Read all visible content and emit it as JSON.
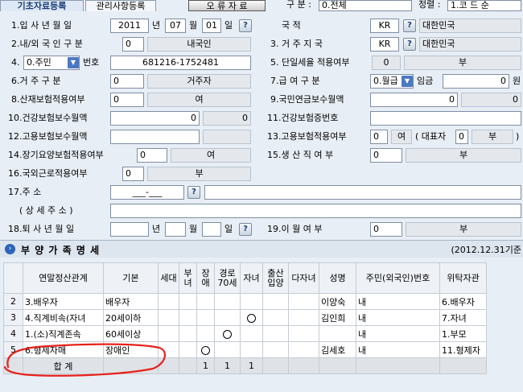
{
  "tabs": {
    "basic": "기초자료등록",
    "management": "관리사항등록"
  },
  "toolbar": {
    "error_button": "오 류 자 료",
    "gubun_label": "구 분 :",
    "gubun_value": "0.전체",
    "sort_label": "정렬 :",
    "sort_value": "1.코 드 순"
  },
  "form": {
    "f1_label": "1.입 사 년 월 일",
    "f1_year": "2011",
    "f1_year_unit": "년",
    "f1_month": "07",
    "f1_month_unit": "월",
    "f1_day": "01",
    "f1_day_unit": "일",
    "country_label": "국                적",
    "country_code": "KR",
    "country_name": "대한민국",
    "f2_label": "2.내/외 국 인 구 분",
    "f2_code": "0",
    "f2_value": "내국인",
    "f3_label": "3. 거  주  지  국",
    "f3_code": "KR",
    "f3_name": "대한민국",
    "f4_label": "4.",
    "f4_select": "0.주민",
    "f4_sub": "번호",
    "f4_value": "681216-1752481",
    "f5_label": "5. 단일세율 적용여부",
    "f5_code": "0",
    "f5_value": "부",
    "f6_label": "6.거  주  구  분",
    "f6_code": "0",
    "f6_value": "거주자",
    "f7_label": "7.급  여  구  분",
    "f7_select": "0.월급",
    "f7_sub": "임금",
    "f7_value": "0",
    "f7_unit": "원",
    "f8_label": "8.산재보험적용여부",
    "f8_code": "0",
    "f8_value": "여",
    "f9_label": "9.국민연금보수월액",
    "f9_value1": "0",
    "f9_value2": "0",
    "f10_label": "10.건강보험보수월액",
    "f10_value1": "0",
    "f10_value2": "0",
    "f11_label": "11.건강보험증번호",
    "f12_label": "12.고용보험보수월액",
    "f13_label": "13.고용보험적용여부",
    "f13_code": "0",
    "f13_value": "여",
    "f13_rep": "( 대표자",
    "f13_rep_code": "0",
    "f13_rep_value": "부",
    "f13_close": ")",
    "f14_label": "14.장기요양보험적용여부",
    "f14_code": "0",
    "f14_value": "여",
    "f15_label": "15.생  산  직  여  부",
    "f15_code": "0",
    "f15_value": "부",
    "f16_label": "16.국외근로적용여부",
    "f16_code": "0",
    "f16_value": "부",
    "f17_label": "17.주                 소",
    "f17_zip": "___-___",
    "f17b_label": "( 상  세  주  소 )",
    "f18_label": "18.퇴 사 년 월 일",
    "f18_year_unit": "년",
    "f18_month_unit": "월",
    "f18_day_unit": "일",
    "f19_label": "19.이  월  여  부",
    "f19_code": "0",
    "f19_value": "부"
  },
  "section": {
    "title": "부 양 가 족 명 세",
    "date": "(2012.12.31기준"
  },
  "grid": {
    "headers": [
      "연말정산관계",
      "기본",
      "세대",
      "부녀",
      "장애",
      "경로70세",
      "자녀",
      "출산입양",
      "다자녀",
      "성명",
      "주민(외국인)번호",
      "위탁자관"
    ],
    "rows": [
      {
        "no": "2",
        "rel": "3.배우자",
        "basic": "배우자",
        "disabled": "",
        "child": "",
        "name": "이양숙",
        "nat": "내",
        "tail": "6.배우자"
      },
      {
        "no": "3",
        "rel": "4.직계비속(자녀",
        "basic": "20세이하",
        "disabled": "",
        "child": "○",
        "name": "김인희",
        "nat": "내",
        "tail": "7.자녀"
      },
      {
        "no": "4",
        "rel": "1.(소)직계존속",
        "basic": "60세이상",
        "disabled": "",
        "elder": "○",
        "child": "",
        "name": "",
        "nat": "내",
        "tail": "1.부모"
      },
      {
        "no": "5",
        "rel": "6.형제자매",
        "basic": "장애인",
        "disabled": "○",
        "child": "",
        "name": "김세호",
        "nat": "내",
        "tail": "11.형제자"
      }
    ],
    "sum_label": "합   계",
    "sum_values": {
      "disabled": "1",
      "elder": "1",
      "child": "1"
    }
  },
  "annotation": {
    "color": "#e8211b"
  }
}
